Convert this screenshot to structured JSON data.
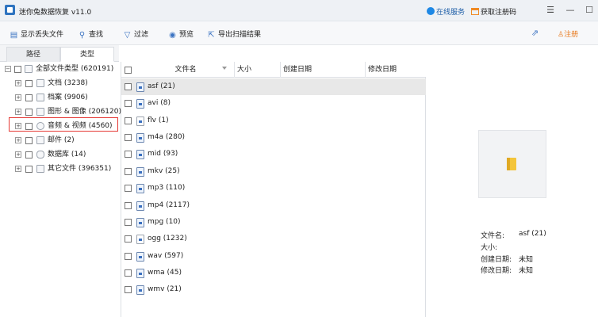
{
  "window": {
    "title": "迷你兔数据恢复 v11.0",
    "online_service": "在线服务",
    "get_code": "获取注册码"
  },
  "toolbar": {
    "show_lost": "显示丢失文件",
    "find": "查找",
    "filter": "过滤",
    "preview": "预览",
    "export": "导出扫描结果",
    "register": "注册"
  },
  "tabs": {
    "path": "路径",
    "type": "类型"
  },
  "tree": {
    "root": "全部文件类型 (620191)",
    "items": [
      {
        "label": "文档 (3238)",
        "icon": "document-icon"
      },
      {
        "label": "档案 (9906)",
        "icon": "archive-icon"
      },
      {
        "label": "图形 & 图像 (206120)",
        "icon": "image-icon"
      },
      {
        "label": "音频 & 视频 (4560)",
        "icon": "media-icon"
      },
      {
        "label": "邮件 (2)",
        "icon": "mail-icon"
      },
      {
        "label": "数据库 (14)",
        "icon": "database-icon"
      },
      {
        "label": "其它文件 (396351)",
        "icon": "folder-icon"
      }
    ]
  },
  "list": {
    "columns": {
      "name": "文件名",
      "size": "大小",
      "created": "创建日期",
      "modified": "修改日期"
    },
    "rows": [
      {
        "name": "asf (21)",
        "selected": true
      },
      {
        "name": "avi (8)"
      },
      {
        "name": "flv (1)"
      },
      {
        "name": "m4a (280)"
      },
      {
        "name": "mid (93)"
      },
      {
        "name": "mkv (25)"
      },
      {
        "name": "mp3 (110)"
      },
      {
        "name": "mp4 (2117)"
      },
      {
        "name": "mpg (10)"
      },
      {
        "name": "ogg (1232)"
      },
      {
        "name": "wav (597)"
      },
      {
        "name": "wma (45)"
      },
      {
        "name": "wmv (21)"
      }
    ]
  },
  "preview": {
    "filename_label": "文件名:",
    "filename_value": "asf (21)",
    "size_label": "大小:",
    "size_value": "",
    "created_label": "创建日期:",
    "created_value": "未知",
    "modified_label": "修改日期:",
    "modified_value": "未知"
  }
}
